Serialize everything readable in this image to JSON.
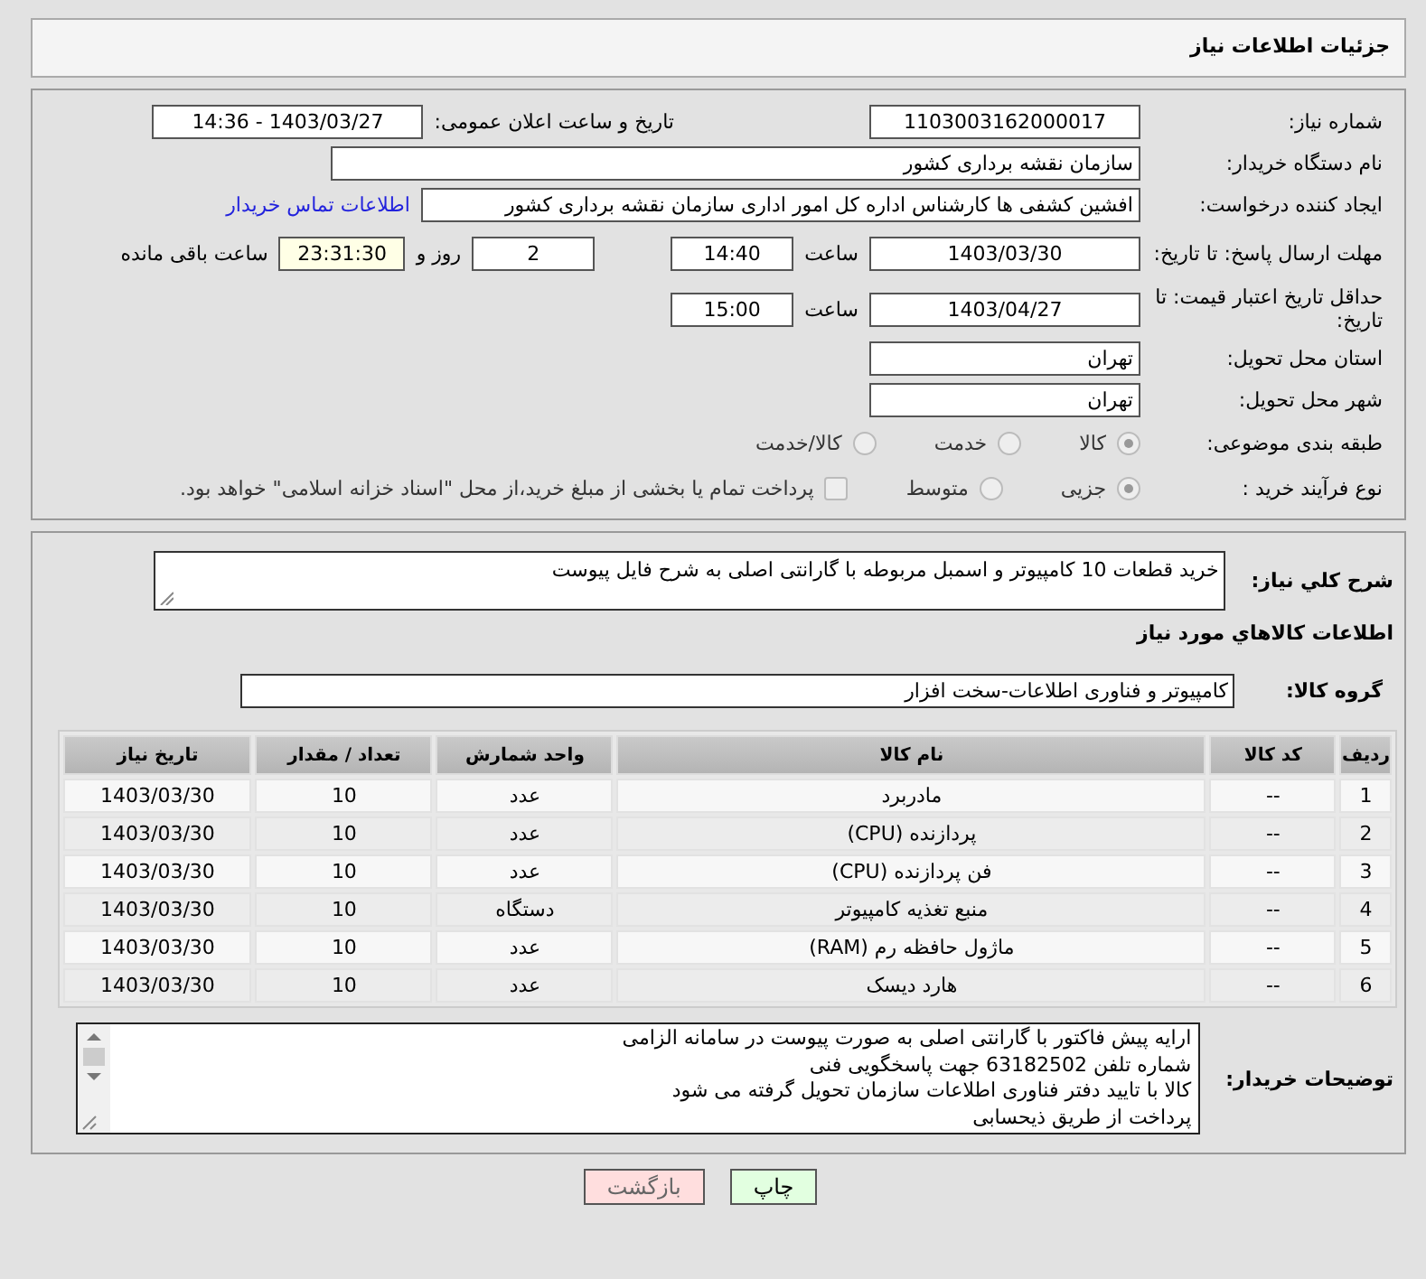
{
  "page_title": "جزئیات اطلاعات نیاز",
  "need_number": {
    "label": "شماره نیاز:",
    "value": "1103003162000017"
  },
  "announce": {
    "label": "تاریخ و ساعت اعلان عمومی:",
    "value": "1403/03/27 - 14:36"
  },
  "buyer_org": {
    "label": "نام دستگاه خریدار:",
    "value": "سازمان نقشه برداری کشور"
  },
  "requester": {
    "label": "ایجاد کننده درخواست:",
    "value": "افشین کشفی ها کارشناس اداره کل امور اداری سازمان نقشه برداری کشور",
    "contact_link": "اطلاعات تماس خریدار"
  },
  "reply_deadline": {
    "label": "مهلت ارسال پاسخ: تا تاریخ:",
    "date": "1403/03/30",
    "time_label": "ساعت",
    "time": "14:40",
    "days": "2",
    "days_label": "روز و",
    "remaining": "23:31:30",
    "remaining_label": "ساعت باقی مانده"
  },
  "price_validity": {
    "label": "حداقل تاریخ اعتبار قیمت: تا تاریخ:",
    "date": "1403/04/27",
    "time_label": "ساعت",
    "time": "15:00"
  },
  "province": {
    "label": "استان محل تحویل:",
    "value": "تهران"
  },
  "city": {
    "label": "شهر محل تحویل:",
    "value": "تهران"
  },
  "category": {
    "label": "طبقه بندی موضوعی:",
    "options": [
      {
        "label": "کالا",
        "selected": true
      },
      {
        "label": "خدمت",
        "selected": false
      },
      {
        "label": "کالا/خدمت",
        "selected": false
      }
    ]
  },
  "purchase_process": {
    "label": "نوع فرآیند خرید :",
    "options": [
      {
        "label": "جزیی",
        "selected": true
      },
      {
        "label": "متوسط",
        "selected": false
      }
    ],
    "treasury": {
      "label": "پرداخت تمام یا بخشی از مبلغ خرید،از محل \"اسناد خزانه اسلامی\" خواهد بود.",
      "checked": false
    }
  },
  "description": {
    "label": "شرح کلي نیاز:",
    "value": "خرید قطعات 10 کامپیوتر و اسمبل مربوطه با گارانتی اصلی به شرح فایل پیوست"
  },
  "goods_title": "اطلاعات کالاهاي مورد نیاز",
  "goods_group": {
    "label": "گروه کالا:",
    "value": "کامپیوتر و فناوری اطلاعات-سخت افزار"
  },
  "table": {
    "columns": [
      "ردیف",
      "کد کالا",
      "نام کالا",
      "واحد شمارش",
      "تعداد / مقدار",
      "تاریخ نیاز"
    ],
    "rows": [
      [
        "1",
        "--",
        "مادربرد",
        "عدد",
        "10",
        "1403/03/30"
      ],
      [
        "2",
        "--",
        "پردازنده (CPU)",
        "عدد",
        "10",
        "1403/03/30"
      ],
      [
        "3",
        "--",
        "فن پردازنده (CPU)",
        "عدد",
        "10",
        "1403/03/30"
      ],
      [
        "4",
        "--",
        "منبع تغذیه کامپیوتر",
        "دستگاه",
        "10",
        "1403/03/30"
      ],
      [
        "5",
        "--",
        "ماژول حافظه رم (RAM)",
        "عدد",
        "10",
        "1403/03/30"
      ],
      [
        "6",
        "--",
        "هارد دیسک",
        "عدد",
        "10",
        "1403/03/30"
      ]
    ]
  },
  "buyer_notes": {
    "label": "توضیحات خریدار:",
    "lines": [
      "ارایه پیش فاکتور با گارانتی اصلی به صورت پیوست در سامانه الزامی",
      "شماره تلفن 63182502 جهت پاسخگویی فنی",
      "کالا با تایید دفتر فناوری اطلاعات سازمان تحویل گرفته می شود",
      "پرداخت از طریق ذیحسابی"
    ]
  },
  "buttons": [
    {
      "label": "چاپ",
      "kind": "print"
    },
    {
      "label": "بازگشت",
      "kind": "back"
    }
  ]
}
